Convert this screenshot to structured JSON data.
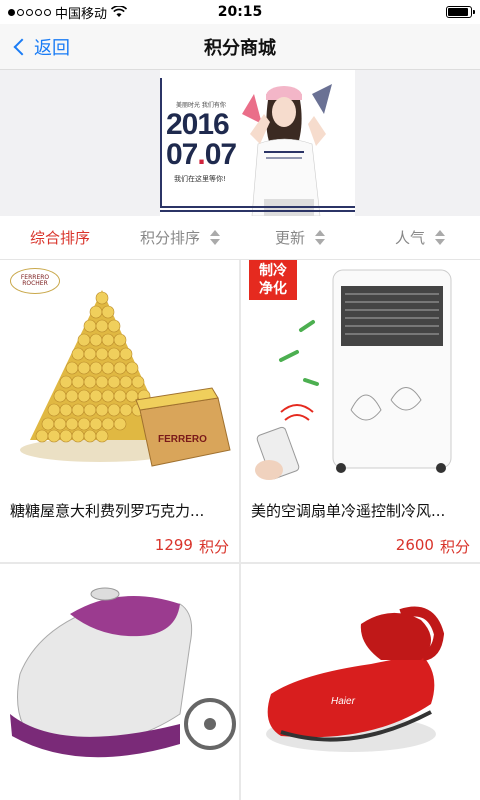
{
  "status_bar": {
    "carrier": "中国移动",
    "time": "20:15"
  },
  "nav": {
    "back_label": "返回",
    "title": "积分商城"
  },
  "banner": {
    "year": "2016",
    "date_part1": "07",
    "date_dot": ".",
    "date_part2": "07",
    "small_text": "美丽时光 我们有你",
    "sub_text": "我们在这里等你!"
  },
  "sort": {
    "items": [
      {
        "label": "综合排序",
        "active": true
      },
      {
        "label": "积分排序",
        "active": false
      },
      {
        "label": "更新",
        "active": false
      },
      {
        "label": "人气",
        "active": false
      }
    ]
  },
  "products": [
    {
      "title": "糖糖屋意大利费列罗巧克力...",
      "points": "1299",
      "unit": "积分",
      "badge": "FERRERO ROCHER",
      "box_label": "FERRERO"
    },
    {
      "title": "美的空调扇单冷遥控制冷风...",
      "points": "2600",
      "unit": "积分",
      "badge_line1": "制冷",
      "badge_line2": "净化"
    },
    {
      "title": "",
      "points": "",
      "unit": ""
    },
    {
      "title": "",
      "points": "",
      "unit": "",
      "brand": "Haier"
    }
  ],
  "colors": {
    "accent_red": "#d9342b",
    "ios_blue": "#1a7cf5"
  }
}
